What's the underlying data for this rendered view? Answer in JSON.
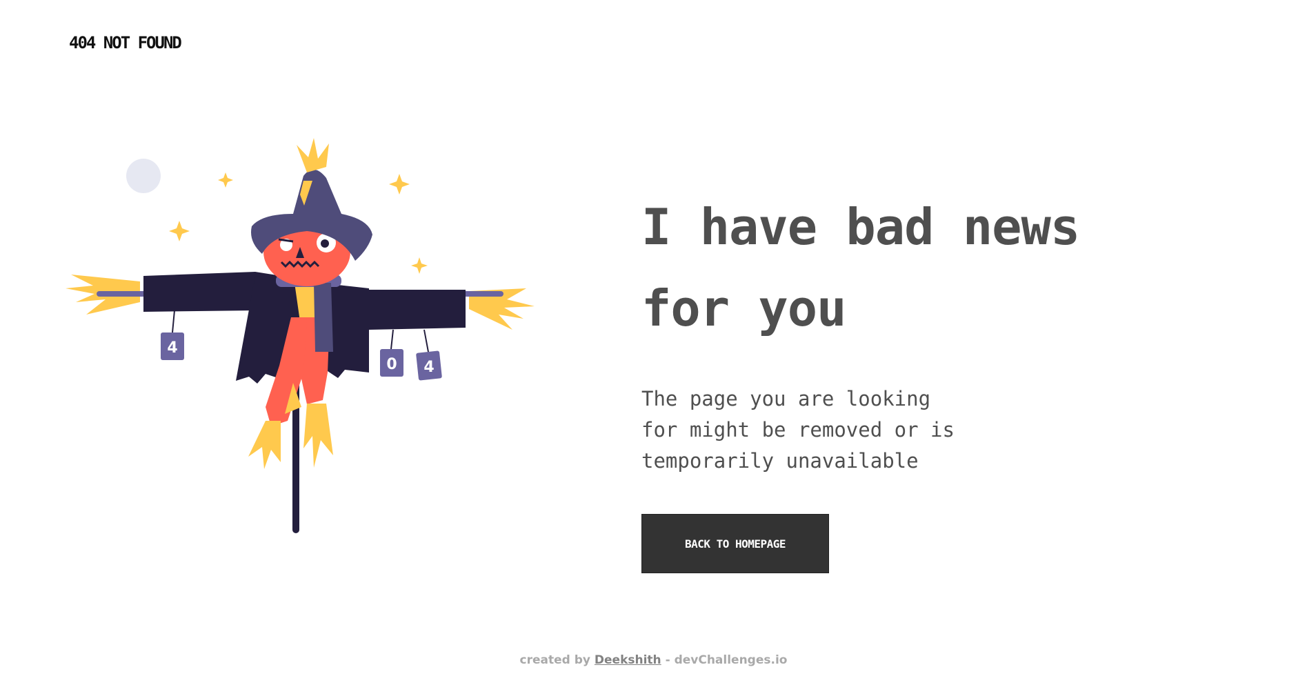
{
  "header": {
    "brand": "404 NOT FOUND"
  },
  "hero": {
    "headline_line1": "I have bad news",
    "headline_line2": "for you",
    "message_line1": "The page you are looking",
    "message_line2": "for might be removed or is",
    "message_line3": "temporarily unavailable",
    "button_label": "BACK TO HOMEPAGE"
  },
  "illustration": {
    "subject": "scarecrow",
    "can_labels": [
      "4",
      "0",
      "4"
    ]
  },
  "footer": {
    "prefix": "created by",
    "author": "Deekshith",
    "suffix": "- devChallenges.io"
  },
  "colors": {
    "text": "#4F4F4F",
    "button_bg": "#333333",
    "footer_text": "#A9A9A9",
    "hat": "#4F4C7A",
    "coat": "#231E3D",
    "pumpkin": "#FF6150",
    "straw": "#FFC94D"
  }
}
